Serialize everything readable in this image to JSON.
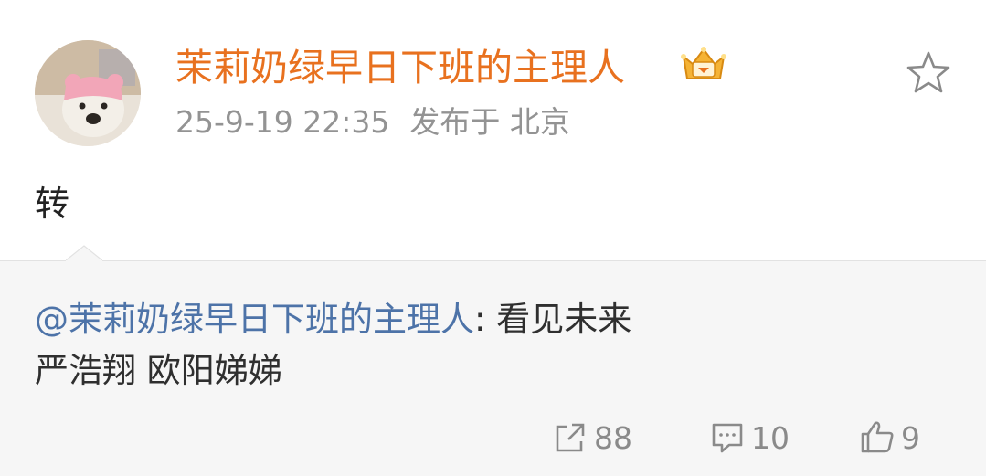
{
  "post": {
    "username": "茉莉奶绿早日下班的主理人",
    "time": "25-9-19 22:35",
    "location": "发布于 北京",
    "text": "转",
    "badge_icon": "vip-crown-icon",
    "favorite_icon": "star-outline-icon"
  },
  "repost": {
    "mention": "@茉莉奶绿早日下班的主理人",
    "separator": ": ",
    "text_line1": "看见未来",
    "text_line2": "严浩翔 欧阳娣娣"
  },
  "actions": {
    "share_count": "88",
    "comment_count": "10",
    "like_count": "9"
  },
  "colors": {
    "username": "#e8711f",
    "mention": "#4d73a8",
    "meta": "#939393",
    "repost_bg": "#f6f6f6"
  }
}
